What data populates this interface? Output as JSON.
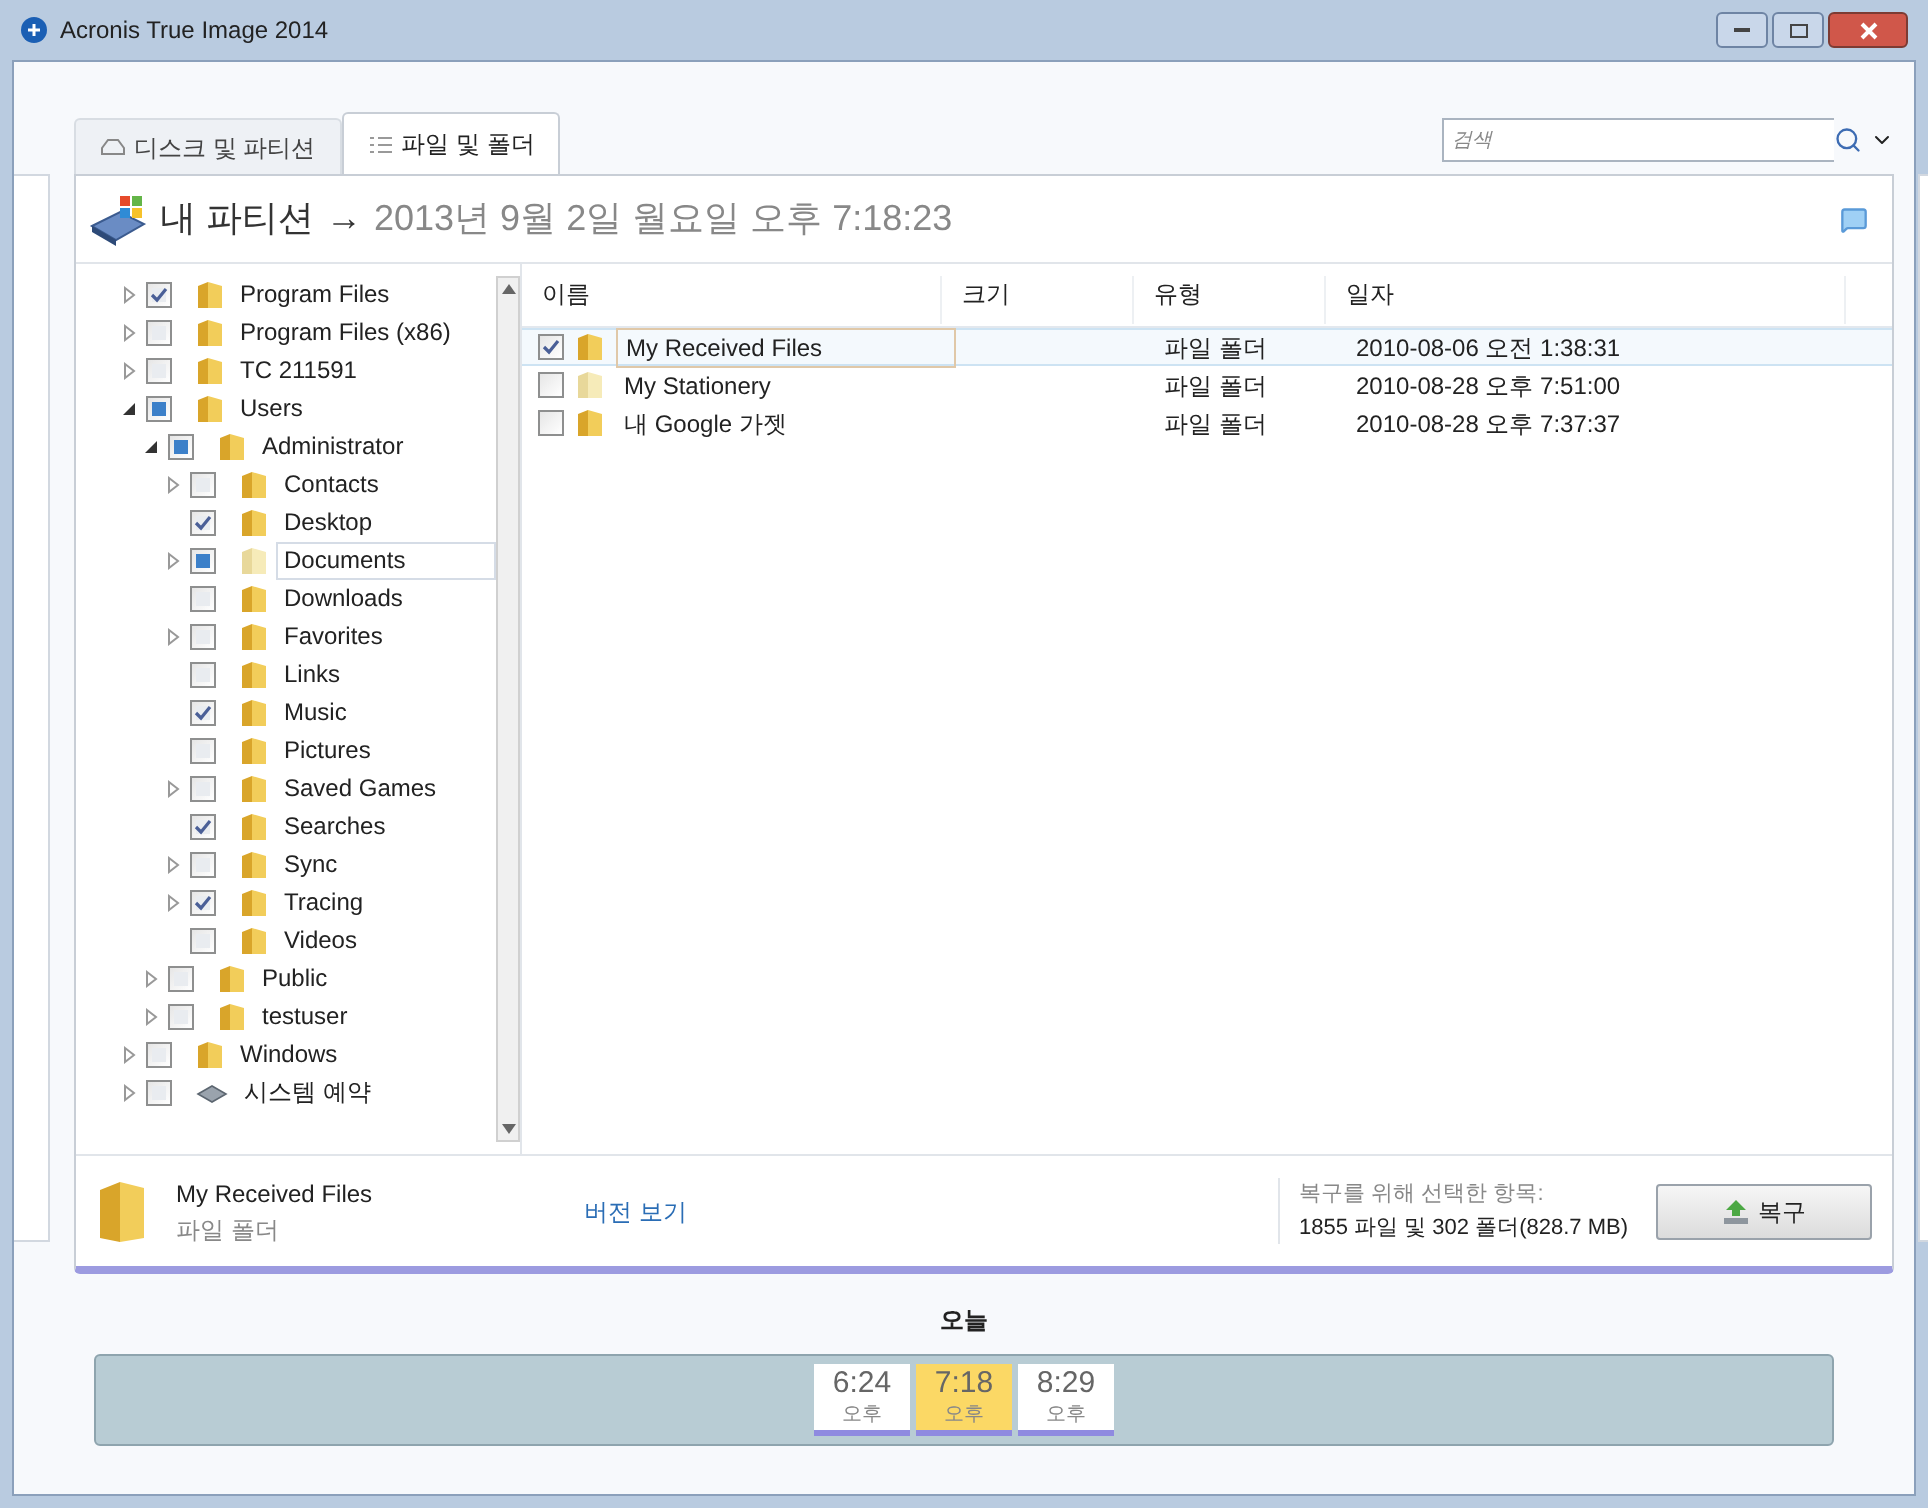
{
  "window": {
    "title": "Acronis True Image 2014"
  },
  "tabs": [
    {
      "label": "디스크 및 파티션",
      "selected": false
    },
    {
      "label": "파일 및 폴더",
      "selected": true
    }
  ],
  "search": {
    "placeholder": "검색"
  },
  "breadcrumb": {
    "source": "내 파티션",
    "arrow": "→",
    "date": "2013년 9월 2일 월요일 오후 7:18:23"
  },
  "tree": [
    {
      "label": "Program Files",
      "checked": true,
      "partial": false,
      "expandable": true,
      "expanded": false,
      "selected": false
    },
    {
      "label": "Program Files (x86)",
      "checked": false,
      "partial": false,
      "expandable": true,
      "expanded": false,
      "selected": false
    },
    {
      "label": "TC 211591",
      "checked": false,
      "partial": false,
      "expandable": true,
      "expanded": false,
      "selected": false
    },
    {
      "label": "Users",
      "checked": false,
      "partial": true,
      "expandable": true,
      "expanded": true,
      "selected": false,
      "children": [
        {
          "label": "Administrator",
          "checked": false,
          "partial": true,
          "expandable": true,
          "expanded": true,
          "selected": false,
          "children": [
            {
              "label": "Contacts",
              "checked": false,
              "partial": false,
              "expandable": true,
              "expanded": false,
              "selected": false
            },
            {
              "label": "Desktop",
              "checked": true,
              "partial": false,
              "expandable": false,
              "expanded": false,
              "selected": false
            },
            {
              "label": "Documents",
              "checked": false,
              "partial": true,
              "expandable": true,
              "expanded": false,
              "selected": true
            },
            {
              "label": "Downloads",
              "checked": false,
              "partial": false,
              "expandable": false,
              "expanded": false,
              "selected": false
            },
            {
              "label": "Favorites",
              "checked": false,
              "partial": false,
              "expandable": true,
              "expanded": false,
              "selected": false
            },
            {
              "label": "Links",
              "checked": false,
              "partial": false,
              "expandable": false,
              "expanded": false,
              "selected": false
            },
            {
              "label": "Music",
              "checked": true,
              "partial": false,
              "expandable": false,
              "expanded": false,
              "selected": false
            },
            {
              "label": "Pictures",
              "checked": false,
              "partial": false,
              "expandable": false,
              "expanded": false,
              "selected": false
            },
            {
              "label": "Saved Games",
              "checked": false,
              "partial": false,
              "expandable": true,
              "expanded": false,
              "selected": false
            },
            {
              "label": "Searches",
              "checked": true,
              "partial": false,
              "expandable": false,
              "expanded": false,
              "selected": false
            },
            {
              "label": "Sync",
              "checked": false,
              "partial": false,
              "expandable": true,
              "expanded": false,
              "selected": false
            },
            {
              "label": "Tracing",
              "checked": true,
              "partial": false,
              "expandable": true,
              "expanded": false,
              "selected": false
            },
            {
              "label": "Videos",
              "checked": false,
              "partial": false,
              "expandable": false,
              "expanded": false,
              "selected": false
            }
          ]
        },
        {
          "label": "Public",
          "checked": false,
          "partial": false,
          "expandable": true,
          "expanded": false,
          "selected": false
        },
        {
          "label": "testuser",
          "checked": false,
          "partial": false,
          "expandable": true,
          "expanded": false,
          "selected": false
        }
      ]
    },
    {
      "label": "Windows",
      "checked": false,
      "partial": false,
      "expandable": true,
      "expanded": false,
      "selected": false
    },
    {
      "label": "시스템 예약",
      "kind": "drive",
      "checked": false,
      "partial": false,
      "expandable": true,
      "expanded": false,
      "selected": false
    }
  ],
  "table": {
    "columns": [
      "이름",
      "크기",
      "유형",
      "일자"
    ],
    "rows": [
      {
        "name": "My Received Files",
        "type": "파일 폴더",
        "date": "2010-08-06 오전 1:38:31",
        "checked": true,
        "selected": true
      },
      {
        "name": "My Stationery",
        "type": "파일 폴더",
        "date": "2010-08-28 오후 7:51:00",
        "checked": false,
        "selected": false
      },
      {
        "name": "내 Google 가젯",
        "type": "파일 폴더",
        "date": "2010-08-28 오후 7:37:37",
        "checked": false,
        "selected": false
      }
    ]
  },
  "details": {
    "name": "My Received Files",
    "type": "파일 폴더",
    "versions_link": "버전 보기",
    "selection_label": "복구를 위해 선택한 항목:",
    "selection_summary": "1855 파일 및 302 폴더(828.7 MB)",
    "recover_button": "복구"
  },
  "timeline": {
    "label": "오늘",
    "entries": [
      {
        "time": "6:24",
        "period": "오후",
        "selected": false
      },
      {
        "time": "7:18",
        "period": "오후",
        "selected": true
      },
      {
        "time": "8:29",
        "period": "오후",
        "selected": false
      }
    ]
  }
}
